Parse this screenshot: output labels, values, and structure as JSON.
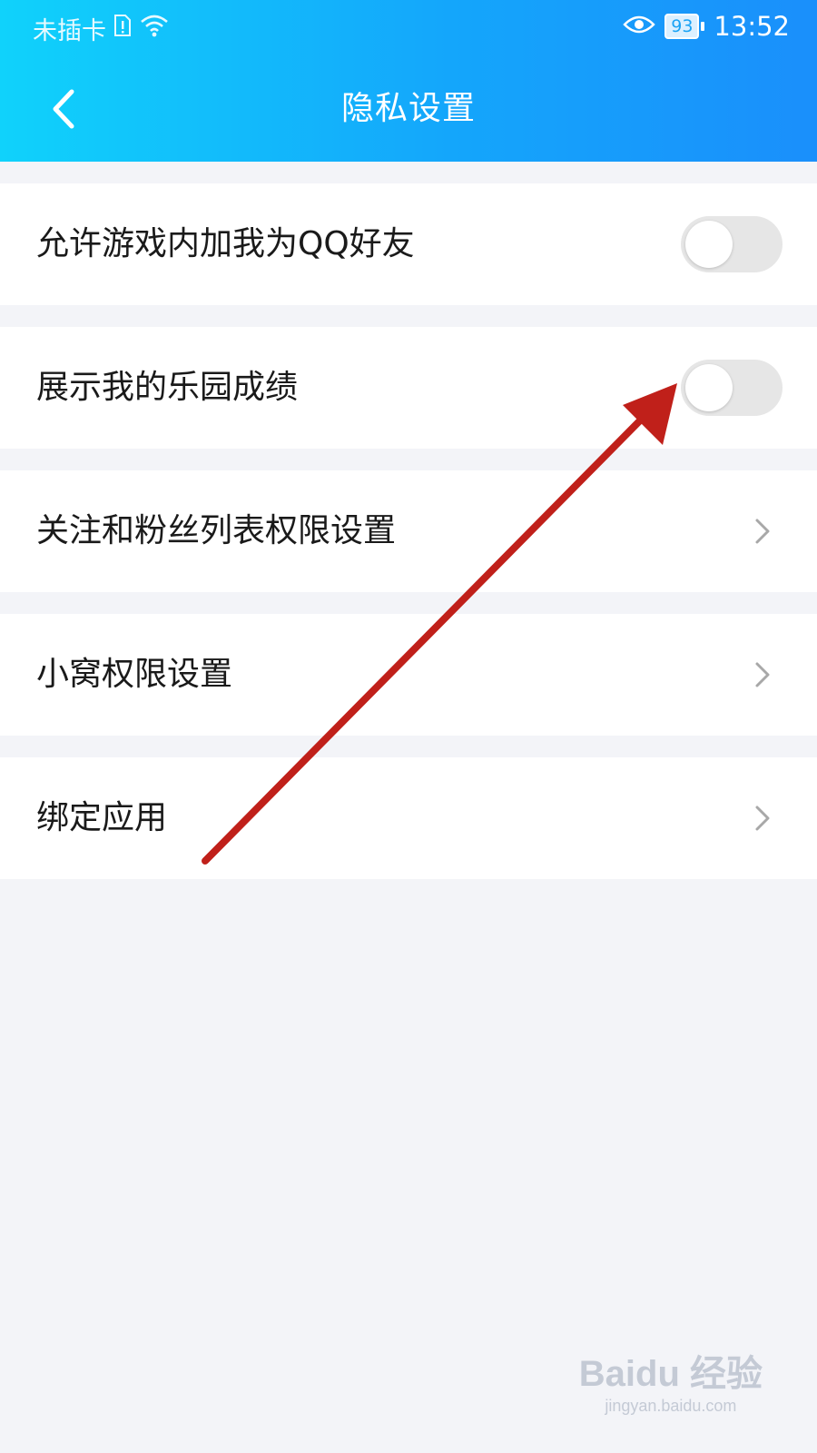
{
  "status_bar": {
    "carrier": "未插卡",
    "battery": "93",
    "time": "13:52"
  },
  "nav": {
    "title": "隐私设置"
  },
  "settings": [
    {
      "label": "允许游戏内加我为QQ好友",
      "type": "toggle",
      "on": false
    },
    {
      "label": "展示我的乐园成绩",
      "type": "toggle",
      "on": false
    },
    {
      "label": "关注和粉丝列表权限设置",
      "type": "link"
    },
    {
      "label": "小窝权限设置",
      "type": "link"
    },
    {
      "label": "绑定应用",
      "type": "link"
    }
  ],
  "watermark": {
    "logo": "Baidu 经验",
    "url": "jingyan.baidu.com"
  },
  "colors": {
    "header_start": "#10d2fb",
    "header_end": "#1a8ffb",
    "annotation_arrow": "#c0201a"
  }
}
